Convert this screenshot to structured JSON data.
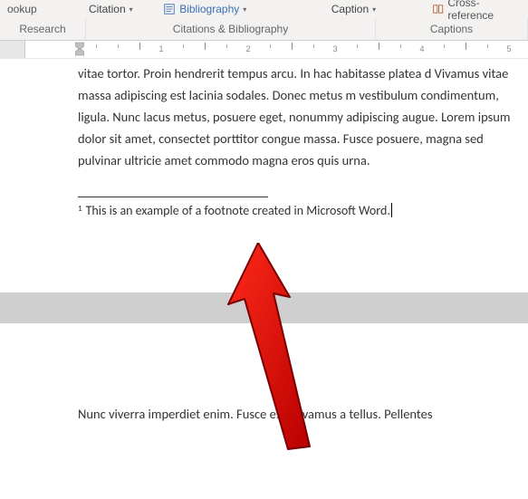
{
  "ribbon": {
    "lookup": "ookup",
    "citation": "Citation",
    "bibliography": "Bibliography",
    "caption": "Caption",
    "crossref": "Cross-reference",
    "groups": {
      "research": "Research",
      "citations": "Citations & Bibliography",
      "captions": "Captions"
    }
  },
  "ruler": {
    "numbers": [
      "1",
      "2",
      "3",
      "4",
      "5"
    ]
  },
  "document": {
    "body1": "vitae tortor. Proin hendrerit tempus arcu. In hac habitasse platea d Vivamus vitae massa adipiscing est lacinia sodales. Donec metus m vestibulum condimentum, ligula. Nunc lacus metus, posuere eget, nonummy adipiscing augue. Lorem ipsum dolor sit amet, consectet porttitor congue massa. Fusce posuere, magna sed pulvinar ultricie amet commodo magna eros quis urna.",
    "footnote_num": "1",
    "footnote_text": " This is an example of a footnote created in Microsoft Word.",
    "body2": "Nunc viverra imperdiet enim. Fusce est. Vivamus a tellus. Pellentes"
  }
}
